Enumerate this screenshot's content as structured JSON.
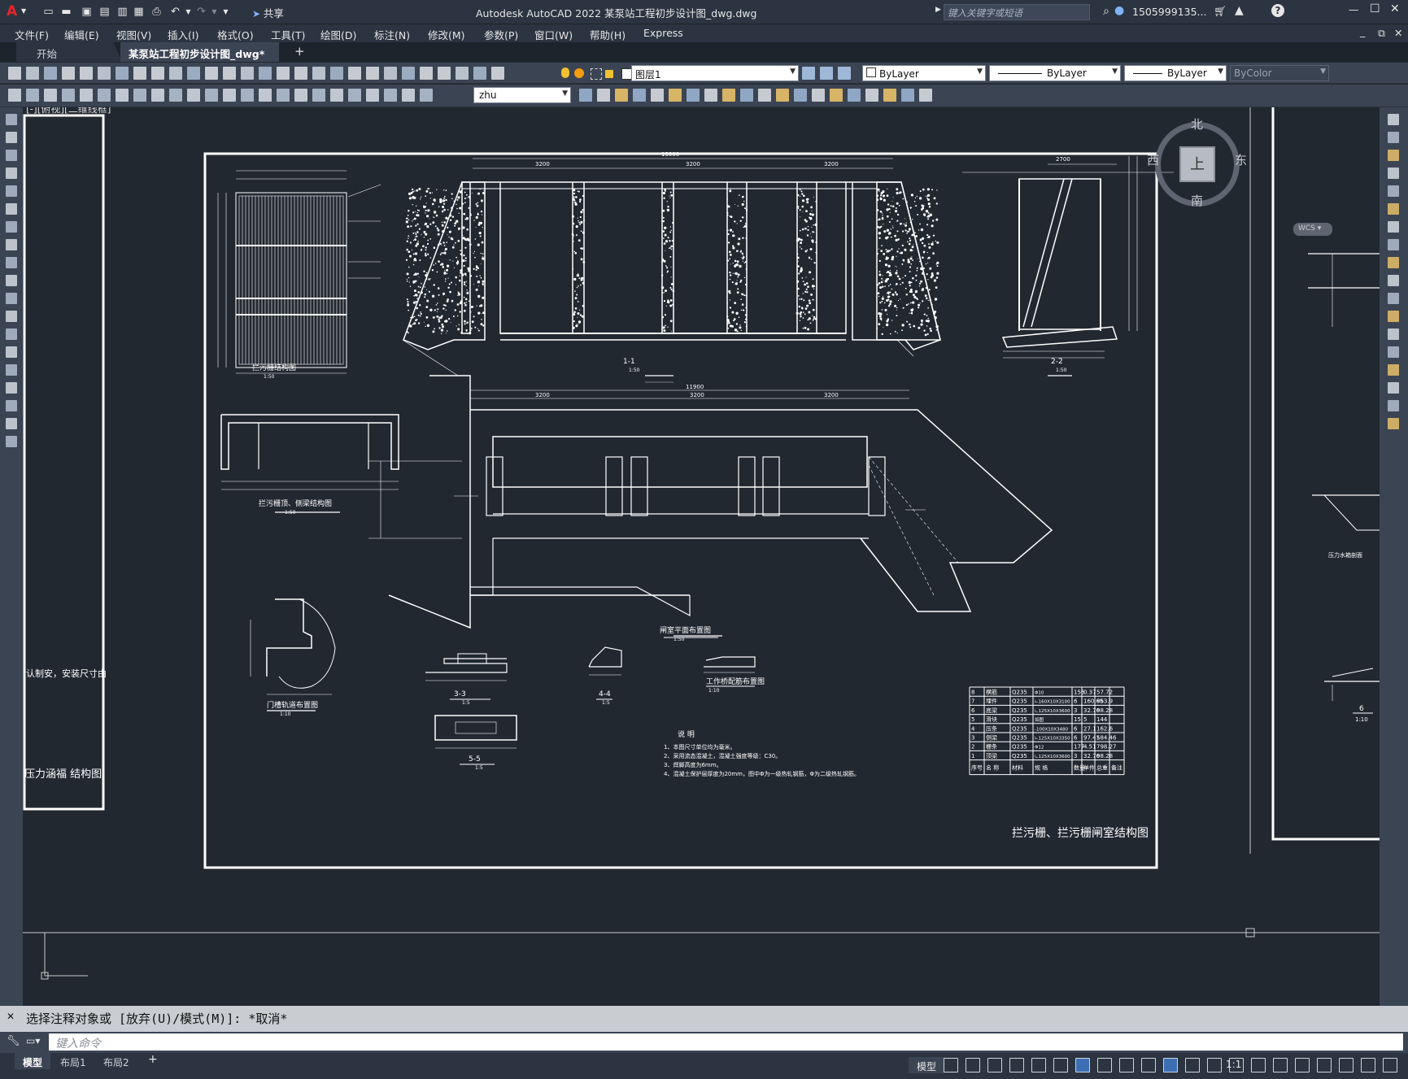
{
  "titlebar": {
    "app_letter": "A",
    "share_label": "共享",
    "title": "Autodesk AutoCAD 2022    某泵站工程初步设计图_dwg.dwg",
    "search_placeholder": "键入关键字或短语",
    "user": "1505999135...",
    "help": "?"
  },
  "menu": [
    "文件(F)",
    "编辑(E)",
    "视图(V)",
    "插入(I)",
    "格式(O)",
    "工具(T)",
    "绘图(D)",
    "标注(N)",
    "修改(M)",
    "参数(P)",
    "窗口(W)",
    "帮助(H)",
    "Express"
  ],
  "tabs": {
    "start": "开始",
    "active": "某泵站工程初步设计图_dwg*",
    "close": "✕",
    "add": "+"
  },
  "toolbar1": {
    "layer_value": "图层1",
    "color_value": "ByLayer",
    "linetype_value": "ByLayer",
    "lineweight_value": "ByLayer",
    "plotstyle_value": "ByColor"
  },
  "toolbar2": {
    "dimstyle_value": "zhu"
  },
  "viewcube": {
    "north": "北",
    "south": "南",
    "east": "东",
    "west": "西",
    "face": "上",
    "wcs": "WCS"
  },
  "drawing": {
    "left_sheet_note": "认制安，安装尺寸由",
    "left_sheet_title": "压力涵福 结构图",
    "left_sheet_header": "[-][俯视][二维线框]",
    "main_title": "拦污栅、拦污栅闸室结构图",
    "section_labels": [
      "拦污栅结构图",
      "1-1",
      "2-2",
      "拦污栅顶、侧梁结构图",
      "闸室平面布置图",
      "门槽轨道布置图",
      "3-3",
      "4-4",
      "5-5",
      "工作桥配筋布置图"
    ],
    "scale_labels": [
      "1:50",
      "1:50",
      "1:50",
      "1:50",
      "1:50",
      "1:10",
      "1:5",
      "1:5",
      "1:5",
      "1:10"
    ],
    "notes_title": "说 明",
    "notes": [
      "1、本图尺寸单位均为毫米。",
      "2、采用流态混凝土，混凝土强度等级：C30。",
      "3、焊脚高度为6mm。",
      "4、混凝土保护层厚度为20mm，图中Φ为一级热轧钢筋，Φ为二级热轧钢筋。"
    ],
    "dims_top": [
      "13000",
      "3200",
      "3200",
      "3200",
      "2700"
    ],
    "dims_plan": [
      "11900",
      "3200",
      "3200",
      "3200"
    ],
    "right_sheet_labels": [
      "压力水箱剖面",
      "6",
      "1:10"
    ]
  },
  "bom": {
    "rows": [
      {
        "no": "8",
        "name": "横筋",
        "mat": "Q235",
        "spec": "Φ10",
        "qty": "156",
        "unit": "0.37",
        "total": "57.72"
      },
      {
        "no": "7",
        "name": "埋件",
        "mat": "Q235",
        "spec": "∟160X10X3100",
        "qty": "6",
        "unit": "160.65",
        "total": "963.9"
      },
      {
        "no": "6",
        "name": "底梁",
        "mat": "Q235",
        "spec": "∟125X10X3600",
        "qty": "3",
        "unit": "32.76",
        "total": "98.28"
      },
      {
        "no": "5",
        "name": "滑块",
        "mat": "Q235",
        "spec": "如图",
        "qty": "15",
        "unit": "5",
        "total": "144"
      },
      {
        "no": "4",
        "name": "压条",
        "mat": "Q235",
        "spec": "-100X10X3480",
        "qty": "6",
        "unit": "27.1",
        "total": "162.6"
      },
      {
        "no": "3",
        "name": "侧梁",
        "mat": "Q235",
        "spec": "∟125X10X3350",
        "qty": "6",
        "unit": "97.41",
        "total": "584.46"
      },
      {
        "no": "2",
        "name": "栅条",
        "mat": "Q235",
        "spec": "Φ12",
        "qty": "177",
        "unit": "4.51",
        "total": "798.27"
      },
      {
        "no": "1",
        "name": "顶梁",
        "mat": "Q235",
        "spec": "∟125X10X3600",
        "qty": "3",
        "unit": "32.76",
        "total": "98.28"
      }
    ],
    "header": {
      "no": "序号",
      "name": "名 称",
      "mat": "材料",
      "spec": "规 格",
      "qty": "数量",
      "unit": "单件",
      "total": "总重",
      "remark": "备注"
    }
  },
  "command": {
    "history": "选择注释对象或 [放弃(U)/模式(M)]: *取消*",
    "placeholder": "键入命令"
  },
  "status": {
    "layout_tabs": [
      "模型",
      "布局1",
      "布局2"
    ],
    "add": "+",
    "model_label": "模型",
    "scale": "1:1"
  }
}
